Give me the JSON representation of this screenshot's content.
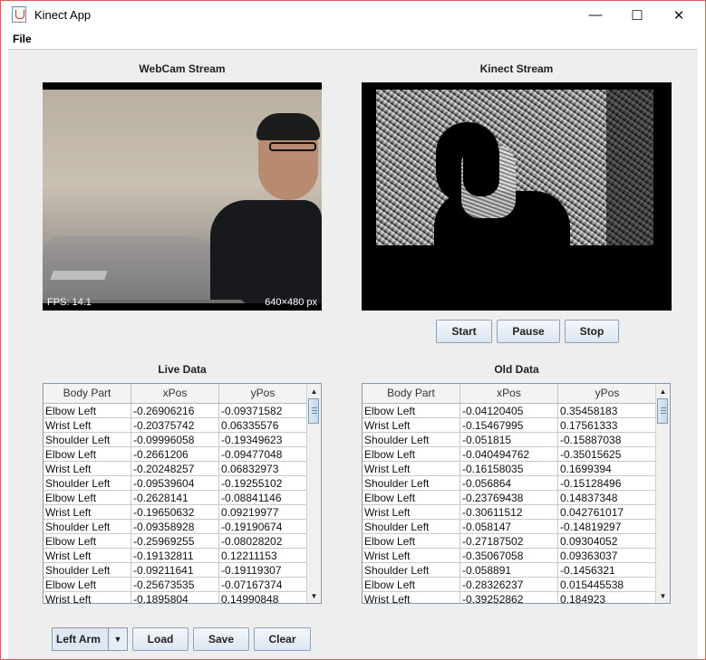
{
  "window": {
    "title": "Kinect App",
    "controls": {
      "minimize": "—",
      "maximize": "☐",
      "close": "✕"
    }
  },
  "menu": {
    "file": "File"
  },
  "webcam": {
    "heading": "WebCam Stream",
    "fps": "FPS: 14.1",
    "resolution": "640×480 px"
  },
  "kinect": {
    "heading": "Kinect Stream"
  },
  "controls": {
    "start": "Start",
    "pause": "Pause",
    "stop": "Stop"
  },
  "live": {
    "heading": "Live Data",
    "columns": [
      "Body Part",
      "xPos",
      "yPos"
    ],
    "rows": [
      [
        "Elbow Left",
        "-0.26906216",
        "-0.09371582"
      ],
      [
        "Wrist Left",
        "-0.20375742",
        "0.06335576"
      ],
      [
        "Shoulder Left",
        "-0.09996058",
        "-0.19349623"
      ],
      [
        "Elbow Left",
        "-0.2661206",
        "-0.09477048"
      ],
      [
        "Wrist Left",
        "-0.20248257",
        "0.06832973"
      ],
      [
        "Shoulder Left",
        "-0.09539604",
        "-0.19255102"
      ],
      [
        "Elbow Left",
        "-0.2628141",
        "-0.08841146"
      ],
      [
        "Wrist Left",
        "-0.19650632",
        "0.09219977"
      ],
      [
        "Shoulder Left",
        "-0.09358928",
        "-0.19190674"
      ],
      [
        "Elbow Left",
        "-0.25969255",
        "-0.08028202"
      ],
      [
        "Wrist Left",
        "-0.19132811",
        "0.12211153"
      ],
      [
        "Shoulder Left",
        "-0.09211641",
        "-0.19119307"
      ],
      [
        "Elbow Left",
        "-0.25673535",
        "-0.07167374"
      ],
      [
        "Wrist Left",
        "-0.1895804",
        "0.14990848"
      ]
    ]
  },
  "old": {
    "heading": "Old Data",
    "columns": [
      "Body Part",
      "xPos",
      "yPos"
    ],
    "rows": [
      [
        "Elbow Left",
        "-0.04120405",
        "0.35458183"
      ],
      [
        "Wrist Left",
        "-0.15467995",
        "0.17561333"
      ],
      [
        "Shoulder Left",
        "-0.051815",
        "-0.15887038"
      ],
      [
        "Elbow Left",
        "-0.040494762",
        "-0.35015625"
      ],
      [
        "Wrist Left",
        "-0.16158035",
        "0.1699394"
      ],
      [
        "Shoulder Left",
        "-0.056864",
        "-0.15128496"
      ],
      [
        "Elbow Left",
        "-0.23769438",
        "0.14837348"
      ],
      [
        "Wrist Left",
        "-0.30611512",
        "0.042761017"
      ],
      [
        "Shoulder Left",
        "-0.058147",
        "-0.14819297"
      ],
      [
        "Elbow Left",
        "-0.27187502",
        "0.09304052"
      ],
      [
        "Wrist Left",
        "-0.35067058",
        "0.09363037"
      ],
      [
        "Shoulder Left",
        "-0.058891",
        "-0.1456321"
      ],
      [
        "Elbow Left",
        "-0.28326237",
        "0.015445538"
      ],
      [
        "Wrist Left",
        "-0.39252862",
        "0.184923"
      ]
    ]
  },
  "bottom": {
    "selector_value": "Left Arm",
    "load": "Load",
    "save": "Save",
    "clear": "Clear"
  }
}
